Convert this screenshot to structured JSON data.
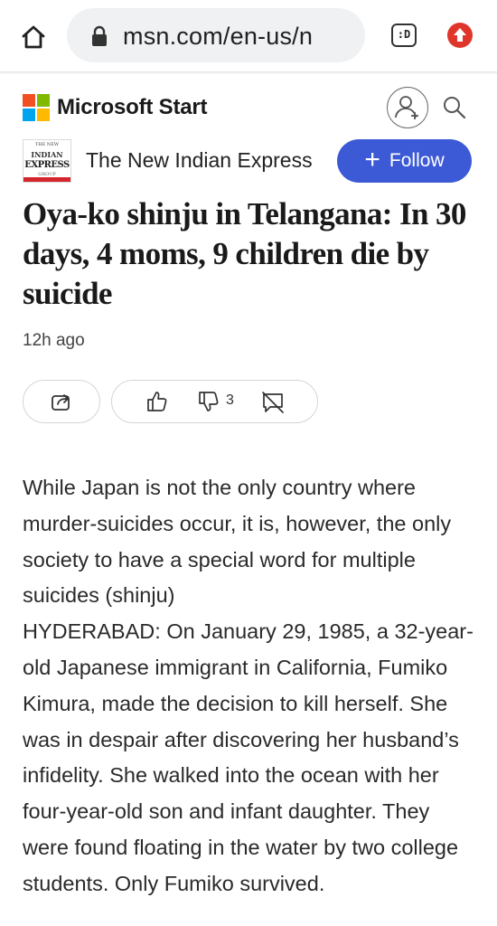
{
  "browser": {
    "url": "msn.com/en-us/n",
    "tabs_indicator": ":D",
    "icons": {
      "home": "home-icon",
      "lock": "lock-icon",
      "update": "update-arrow-icon"
    }
  },
  "header": {
    "brand": "Microsoft Start",
    "icons": {
      "logo": "microsoft-logo-icon",
      "profile": "add-user-icon",
      "search": "search-icon"
    },
    "logo_colors": [
      "#f25022",
      "#7fba00",
      "#00a4ef",
      "#ffb900"
    ]
  },
  "publisher": {
    "name": "The New Indian Express",
    "logo_lines": [
      "THE NEW",
      "INDIAN",
      "EXPRESS",
      "GROUP"
    ],
    "follow_label": "Follow",
    "follow_color": "#3d5ad6"
  },
  "article": {
    "headline": "Oya-ko shinju in Telangana: In 30 days, 4 moms, 9 children die by suicide",
    "timestamp": "12h ago",
    "dislike_count": "3",
    "paragraph_1": "While Japan is not the only country where murder-suicides occur, it is, however, the only society to have a special word for multiple suicides (shinju)",
    "paragraph_2": "HYDERABAD: On January 29, 1985, a 32-year-old Japanese immigrant in California, Fumiko Kimura, made the decision to kill herself. She was in despair after discovering her husband’s infidelity. She walked into the ocean with her four-year-old son and infant daughter. They were found floating in the water by two college students. Only Fumiko survived."
  }
}
